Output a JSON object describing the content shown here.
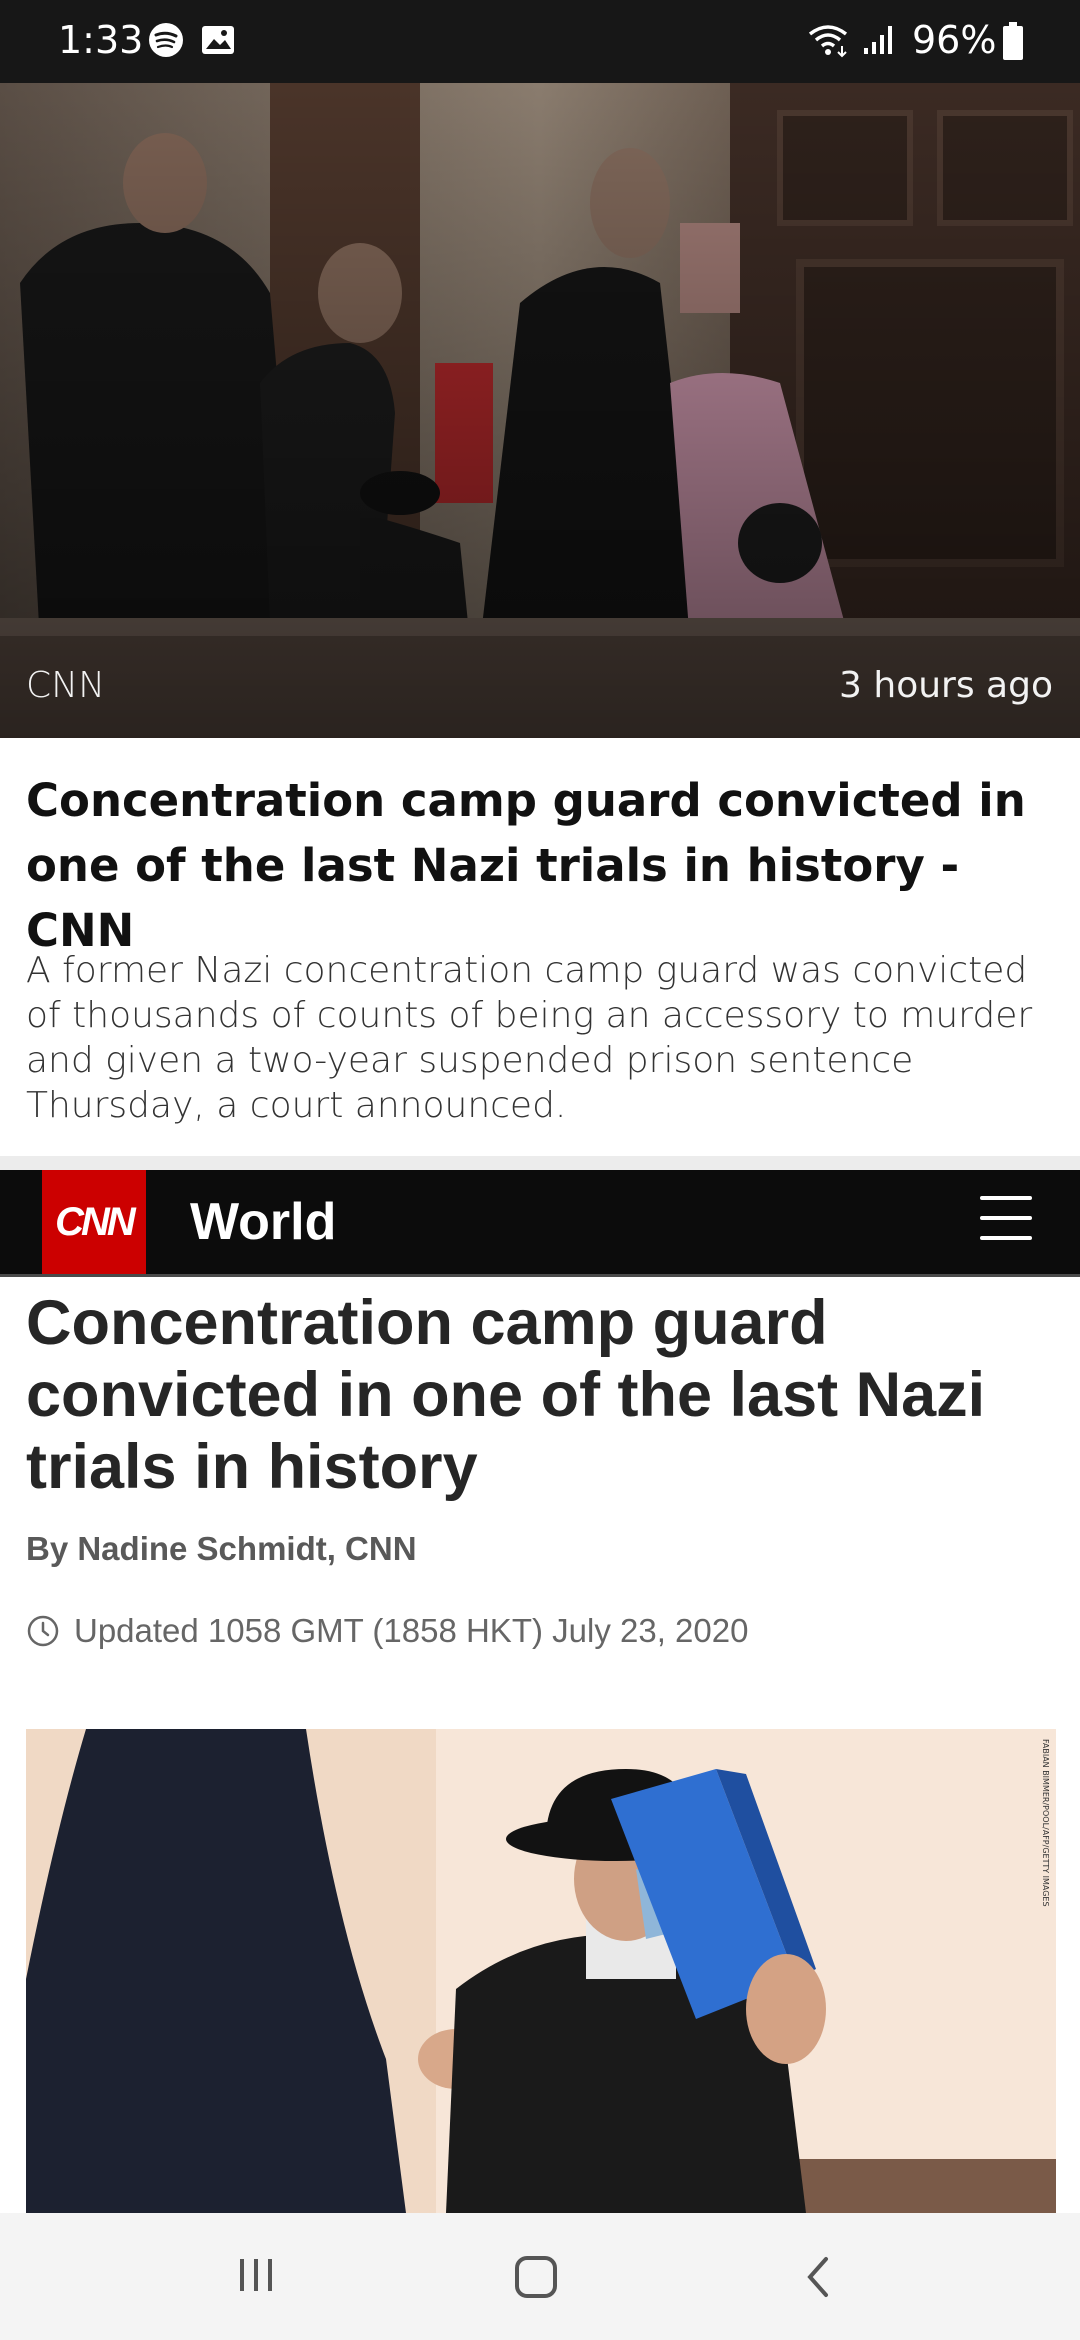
{
  "status_bar": {
    "time": "1:33",
    "battery": "96%",
    "icons": [
      "spotify-icon",
      "gallery-icon",
      "wifi-icon",
      "signal-icon",
      "battery-icon"
    ]
  },
  "hero": {
    "source": "CNN",
    "time_ago": "3 hours ago"
  },
  "card": {
    "title": "Concentration camp guard convicted in one of the last Nazi trials in history - CNN",
    "summary": "A former Nazi concentration camp guard was convicted of thousands of counts of being an accessory to murder and given a two-year suspended prison sentence Thursday, a court announced."
  },
  "cnn_header": {
    "logo_text": "CNN",
    "section": "World",
    "menu_icon": "hamburger-menu-icon",
    "brand_color": "#cc0000"
  },
  "article": {
    "headline": "Concentration camp guard convicted in one of the last Nazi trials in history",
    "byline": "By Nadine Schmidt, CNN",
    "updated": "Updated 1058 GMT (1858 HKT) July 23, 2020",
    "photo_credit": "FABIAN BIMMER/POOL/AFP/GETTY IMAGES"
  },
  "nav_bar": {
    "buttons": [
      "recent-apps-icon",
      "home-icon",
      "back-icon"
    ]
  }
}
